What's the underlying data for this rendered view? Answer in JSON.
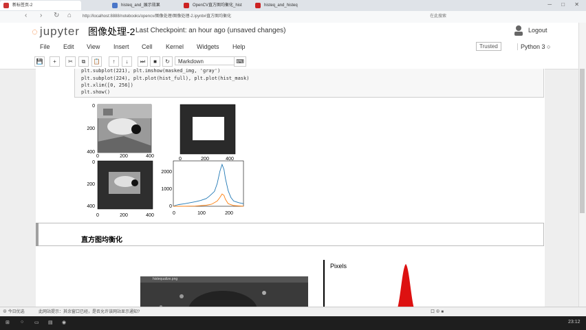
{
  "browser": {
    "tabs": [
      {
        "label": "新标签页-2",
        "color": "#cc3333"
      },
      {
        "label": "histeq_and_展示效果",
        "color": "#4a76c8"
      },
      {
        "label": "OpenCV直方图均衡化_hist",
        "color": "#cc2222"
      },
      {
        "label": "histeq_and_histeq",
        "color": "#cc2222"
      }
    ],
    "address": "http://localhost:8888/notebooks/opencv/图像处理/图像处理-2.ipynb#直方图均衡化",
    "search_placeholder": "在此搜索",
    "window_controls": "─ □ ✕"
  },
  "jupyter": {
    "logo": "jupyter",
    "notebook_title": "图像处理-2",
    "checkpoint": "Last Checkpoint: an hour ago (unsaved changes)",
    "logout": "Logout",
    "menu": [
      "File",
      "Edit",
      "View",
      "Insert",
      "Cell",
      "Kernel",
      "Widgets",
      "Help"
    ],
    "trusted": "Trusted",
    "kernel": "Python 3",
    "celltype": "Markdown",
    "toolbar_icons": [
      "💾",
      "+",
      "✂",
      "⧉",
      "📋",
      "↑",
      "↓",
      "⏭",
      "■",
      "↻"
    ]
  },
  "code": [
    "plt.subplot(221), plt.imshow(masked_img, 'gray')",
    "plt.subplot(224), plt.plot(hist_full), plt.plot(hist_mask)",
    "plt.xlim([0, 256])",
    "plt.show()"
  ],
  "plots": {
    "image_ticks_y": [
      "0",
      "200",
      "400"
    ],
    "image_ticks_x": [
      "0",
      "200",
      "400"
    ],
    "hist_ticks_y": [
      "0",
      "1000",
      "2000"
    ],
    "hist_ticks_x": [
      "0",
      "100",
      "200"
    ]
  },
  "chart_data": {
    "type": "line",
    "xlabel": "",
    "ylabel": "",
    "xlim": [
      0,
      256
    ],
    "ylim": [
      0,
      2600
    ],
    "series": [
      {
        "color": "#1f77b4",
        "x": [
          0,
          10,
          20,
          40,
          60,
          80,
          100,
          120,
          130,
          140,
          150,
          160,
          170,
          178,
          185,
          190,
          200,
          210,
          220,
          230,
          240,
          256
        ],
        "y": [
          0,
          60,
          100,
          140,
          200,
          260,
          330,
          440,
          560,
          700,
          850,
          1300,
          2000,
          2400,
          2100,
          1600,
          900,
          500,
          300,
          250,
          200,
          150
        ]
      },
      {
        "color": "#ff7f0e",
        "x": [
          0,
          40,
          80,
          120,
          140,
          160,
          170,
          178,
          185,
          190,
          200,
          220,
          256
        ],
        "y": [
          0,
          0,
          10,
          60,
          120,
          300,
          500,
          700,
          620,
          400,
          150,
          40,
          0
        ]
      }
    ]
  },
  "markdown": {
    "heading": "直方图均衡化"
  },
  "bottom": {
    "pixels_label": "Pixels",
    "embedded_title": "histequalize.png"
  },
  "status": {
    "left": "⊕ 今日优选",
    "notice": "此网站提示：其余窗口已经，是否允许该网站显示通知?",
    "right": "口 ⊕ ■"
  },
  "taskbar": {
    "time": "23:12"
  }
}
